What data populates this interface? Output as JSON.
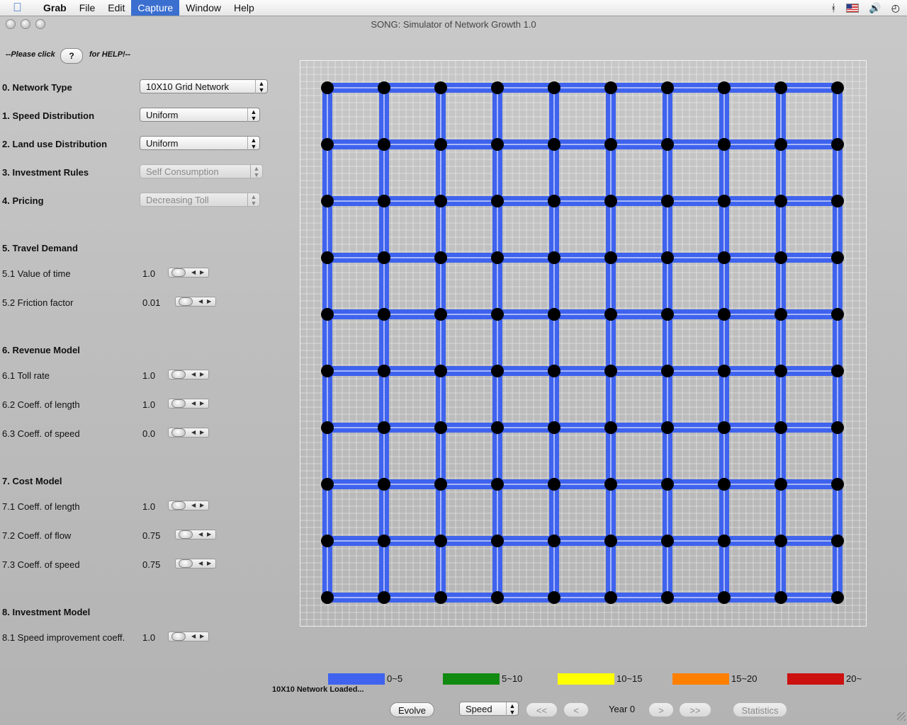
{
  "menubar": {
    "items": [
      "Grab",
      "File",
      "Edit",
      "Capture",
      "Window",
      "Help"
    ],
    "active": "Capture",
    "right_icons": [
      "bluetooth-icon",
      "flag-icon",
      "volume-icon",
      "clock-icon"
    ]
  },
  "window": {
    "title": "SONG: Simulator of Network Growth 1.0"
  },
  "help": {
    "before": "--Please click",
    "button": "?",
    "after": "for HELP!--"
  },
  "params": {
    "network_type": {
      "label": "0. Network Type",
      "value": "10X10 Grid Network"
    },
    "speed_dist": {
      "label": "1. Speed Distribution",
      "value": "Uniform"
    },
    "landuse_dist": {
      "label": "2. Land use Distribution",
      "value": "Uniform"
    },
    "investment_rules": {
      "label": "3. Investment Rules",
      "value": "Self Consumption"
    },
    "pricing": {
      "label": "4. Pricing",
      "value": "Decreasing Toll"
    }
  },
  "sections": {
    "travel_demand": {
      "title": "5. Travel Demand",
      "value_of_time": {
        "label": "5.1 Value of time",
        "value": "1.0"
      },
      "friction": {
        "label": "5.2 Friction factor",
        "value": "0.01"
      }
    },
    "revenue": {
      "title": "6. Revenue Model",
      "toll": {
        "label": "6.1 Toll rate",
        "value": "1.0"
      },
      "length": {
        "label": "6.2 Coeff. of length",
        "value": "1.0"
      },
      "speed": {
        "label": "6.3 Coeff. of speed",
        "value": "0.0"
      }
    },
    "cost": {
      "title": "7. Cost Model",
      "length": {
        "label": "7.1 Coeff. of length",
        "value": "1.0"
      },
      "flow": {
        "label": "7.2 Coeff. of flow",
        "value": "0.75"
      },
      "speed": {
        "label": "7.3 Coeff. of speed",
        "value": "0.75"
      }
    },
    "investment": {
      "title": "8. Investment Model",
      "speed_improvement": {
        "label": "8.1 Speed improvement coeff.",
        "value": "1.0"
      }
    }
  },
  "network": {
    "rows": 10,
    "cols": 10,
    "link_color": "#3f63ee",
    "node_color": "#000000"
  },
  "legend": [
    {
      "label": "0~5",
      "color": "#3f63ee"
    },
    {
      "label": "5~10",
      "color": "#118a11"
    },
    {
      "label": "10~15",
      "color": "#ffff00"
    },
    {
      "label": "15~20",
      "color": "#ff8000"
    },
    {
      "label": "20~",
      "color": "#cc1111"
    }
  ],
  "status": "10X10 Network Loaded...",
  "controls": {
    "evolve": "Evolve",
    "display_select": "Speed",
    "first": "<<",
    "prev": "<",
    "year": "Year 0",
    "next": ">",
    "last": ">>",
    "statistics": "Statistics"
  }
}
